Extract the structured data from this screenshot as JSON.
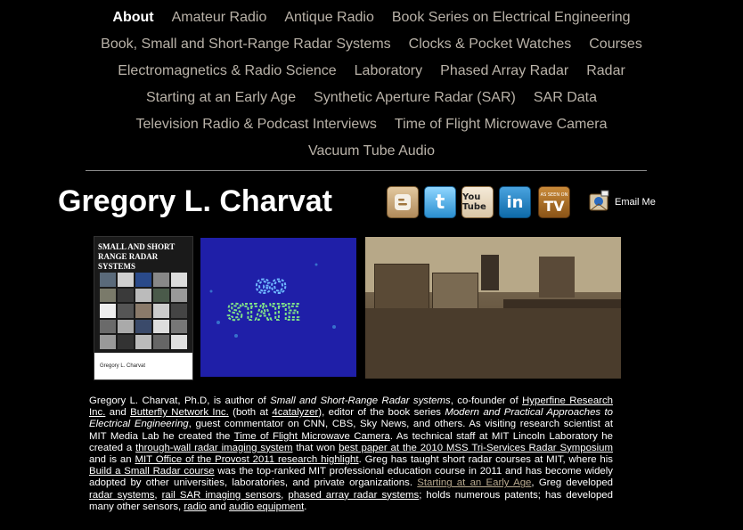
{
  "nav": {
    "rows": [
      [
        "About",
        "Amateur Radio",
        "Antique Radio",
        "Book Series on Electrical Engineering"
      ],
      [
        "Book, Small and Short-Range Radar Systems",
        "Clocks & Pocket Watches",
        "Courses"
      ],
      [
        "Electromagnetics & Radio Science",
        "Laboratory",
        "Phased Array Radar",
        "Radar"
      ],
      [
        "Starting at an Early Age",
        "Synthetic Aperture Radar (SAR)",
        "SAR Data"
      ],
      [
        "Television Radio & Podcast Interviews",
        "Time of Flight Microwave Camera"
      ],
      [
        "Vacuum Tube Audio"
      ]
    ],
    "active": "About"
  },
  "header": {
    "title": "Gregory L. Charvat",
    "email_label": "Email Me",
    "social_icons": [
      "blogger-icon",
      "twitter-icon",
      "youtube-icon",
      "linkedin-icon",
      "as-seen-on-tv-icon"
    ],
    "youtube_text": "You Tube",
    "linkedin_text": "in",
    "tv_small": "AS SEEN ON",
    "tv_big": "TV"
  },
  "images": {
    "book_cover_title": "SMALL AND SHORT RANGE RADAR SYSTEMS",
    "book_cover_author": "Gregory L. Charvat",
    "sar_image_text": "GO STATE"
  },
  "colors": {
    "background": "#000000",
    "nav_text": "#b9b2a8",
    "visited_link": "#b8a98e",
    "sar_background": "#1f1fa8"
  },
  "bio": {
    "t1": "Gregory L. Charvat, Ph.D, is author of ",
    "e1": "Small and Short-Range Radar systems",
    "t2": ", co-founder of ",
    "l_hyperfine": "Hyperfine Research Inc.",
    "t3": " and ",
    "l_butterfly": "Butterfly Network Inc.",
    "t4": " (both at ",
    "l_4catalyzer": "4catalyzer",
    "t5": "), editor of the book series ",
    "e2": "Modern and Practical Approaches to Electrical Engineering",
    "t6": ", guest commentator on CNN, CBS, Sky News, and others. As visiting research scientist at MIT Media Lab he created the ",
    "l_tof": "Time of Flight Microwave Camera",
    "t7": ".  As technical staff at MIT Lincoln Laboratory he created a ",
    "l_twall": "through-wall radar imaging system",
    "t8": " that won ",
    "l_bestpaper": "best paper at the 2010 MSS Tri-Services Radar Symposium",
    "t9": " and is an ",
    "l_provost": "MIT Office of the Provost 2011 research highlight",
    "t10": ". Greg has taught short radar courses at MIT, where his ",
    "l_course": "Build a Small Radar course",
    "t11": " was the top-ranked MIT professional education course in 2011 and has become widely adopted by other universities, laboratories, and private organizations. ",
    "l_early": "Starting at an Early Age",
    "t12": ", Greg developed ",
    "l_radarsys": "radar systems",
    "t13": ", ",
    "l_railsar": "rail SAR imaging sensors",
    "t14": ", ",
    "l_phased": "phased array radar systems",
    "t15": "; holds numerous patents; has developed many other sensors, ",
    "l_radio": "radio",
    "t16": " and ",
    "l_audio": "audio equipment",
    "t17": "."
  }
}
